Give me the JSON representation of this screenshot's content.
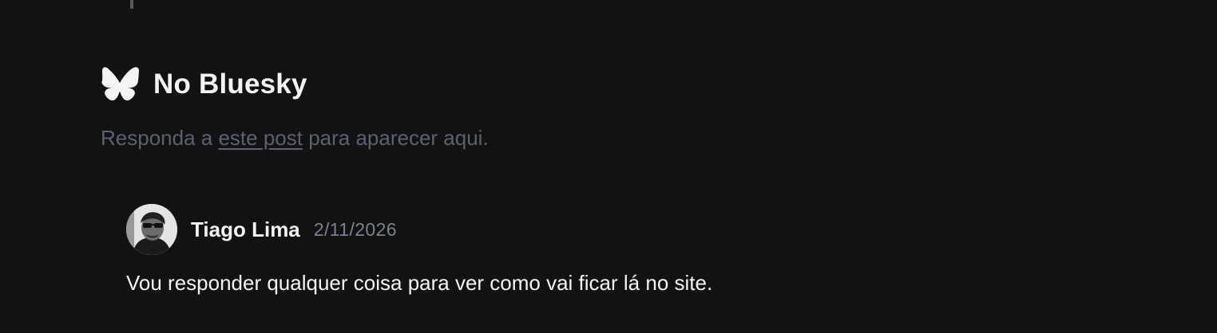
{
  "section": {
    "title": "No Bluesky",
    "icon": "bluesky-butterfly-icon"
  },
  "hint": {
    "before": "Responda a ",
    "link_text": "este post",
    "after": " para aparecer aqui."
  },
  "comment": {
    "author": "Tiago Lima",
    "date": "2/11/2026",
    "text": "Vou responder qualquer coisa para ver como vai ficar lá no site."
  },
  "colors": {
    "background": "#121212",
    "text_primary": "#f4f4f5",
    "text_muted": "#5b6170",
    "date": "#7b8190"
  }
}
